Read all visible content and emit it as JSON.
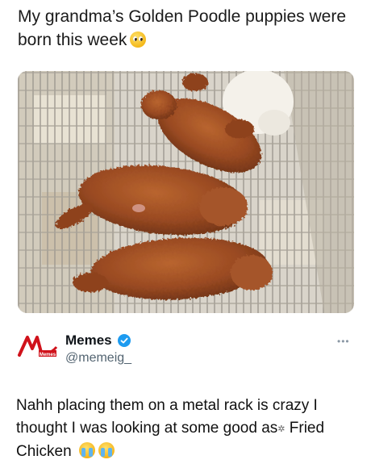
{
  "caption": {
    "line1": "My grandma’s Golden Poodle puppies were",
    "line2": "born this week",
    "emoji": "pleading-face-emoji"
  },
  "photo": {
    "subject": "puppies-on-metal-rack-photo",
    "colors": {
      "puppy": "#9a4a22",
      "rack": "#d8d4cc",
      "fur_white": "#f4f1ea"
    }
  },
  "post": {
    "author_name": "Memes",
    "author_handle": "@memeig_",
    "avatar_logo_text": "Memes",
    "more_label": "•••",
    "text_line1": "Nahh placing them on a metal rack is crazy I",
    "text_line2a": "thought I was looking at some good as",
    "text_glyph": "✲",
    "text_line2b": " Fried",
    "text_line3": "Chicken",
    "emojis": [
      "loudly-crying-face-emoji",
      "loudly-crying-face-emoji"
    ],
    "verified_color": "#1d9bf0",
    "brand_red": "#d0121b"
  }
}
